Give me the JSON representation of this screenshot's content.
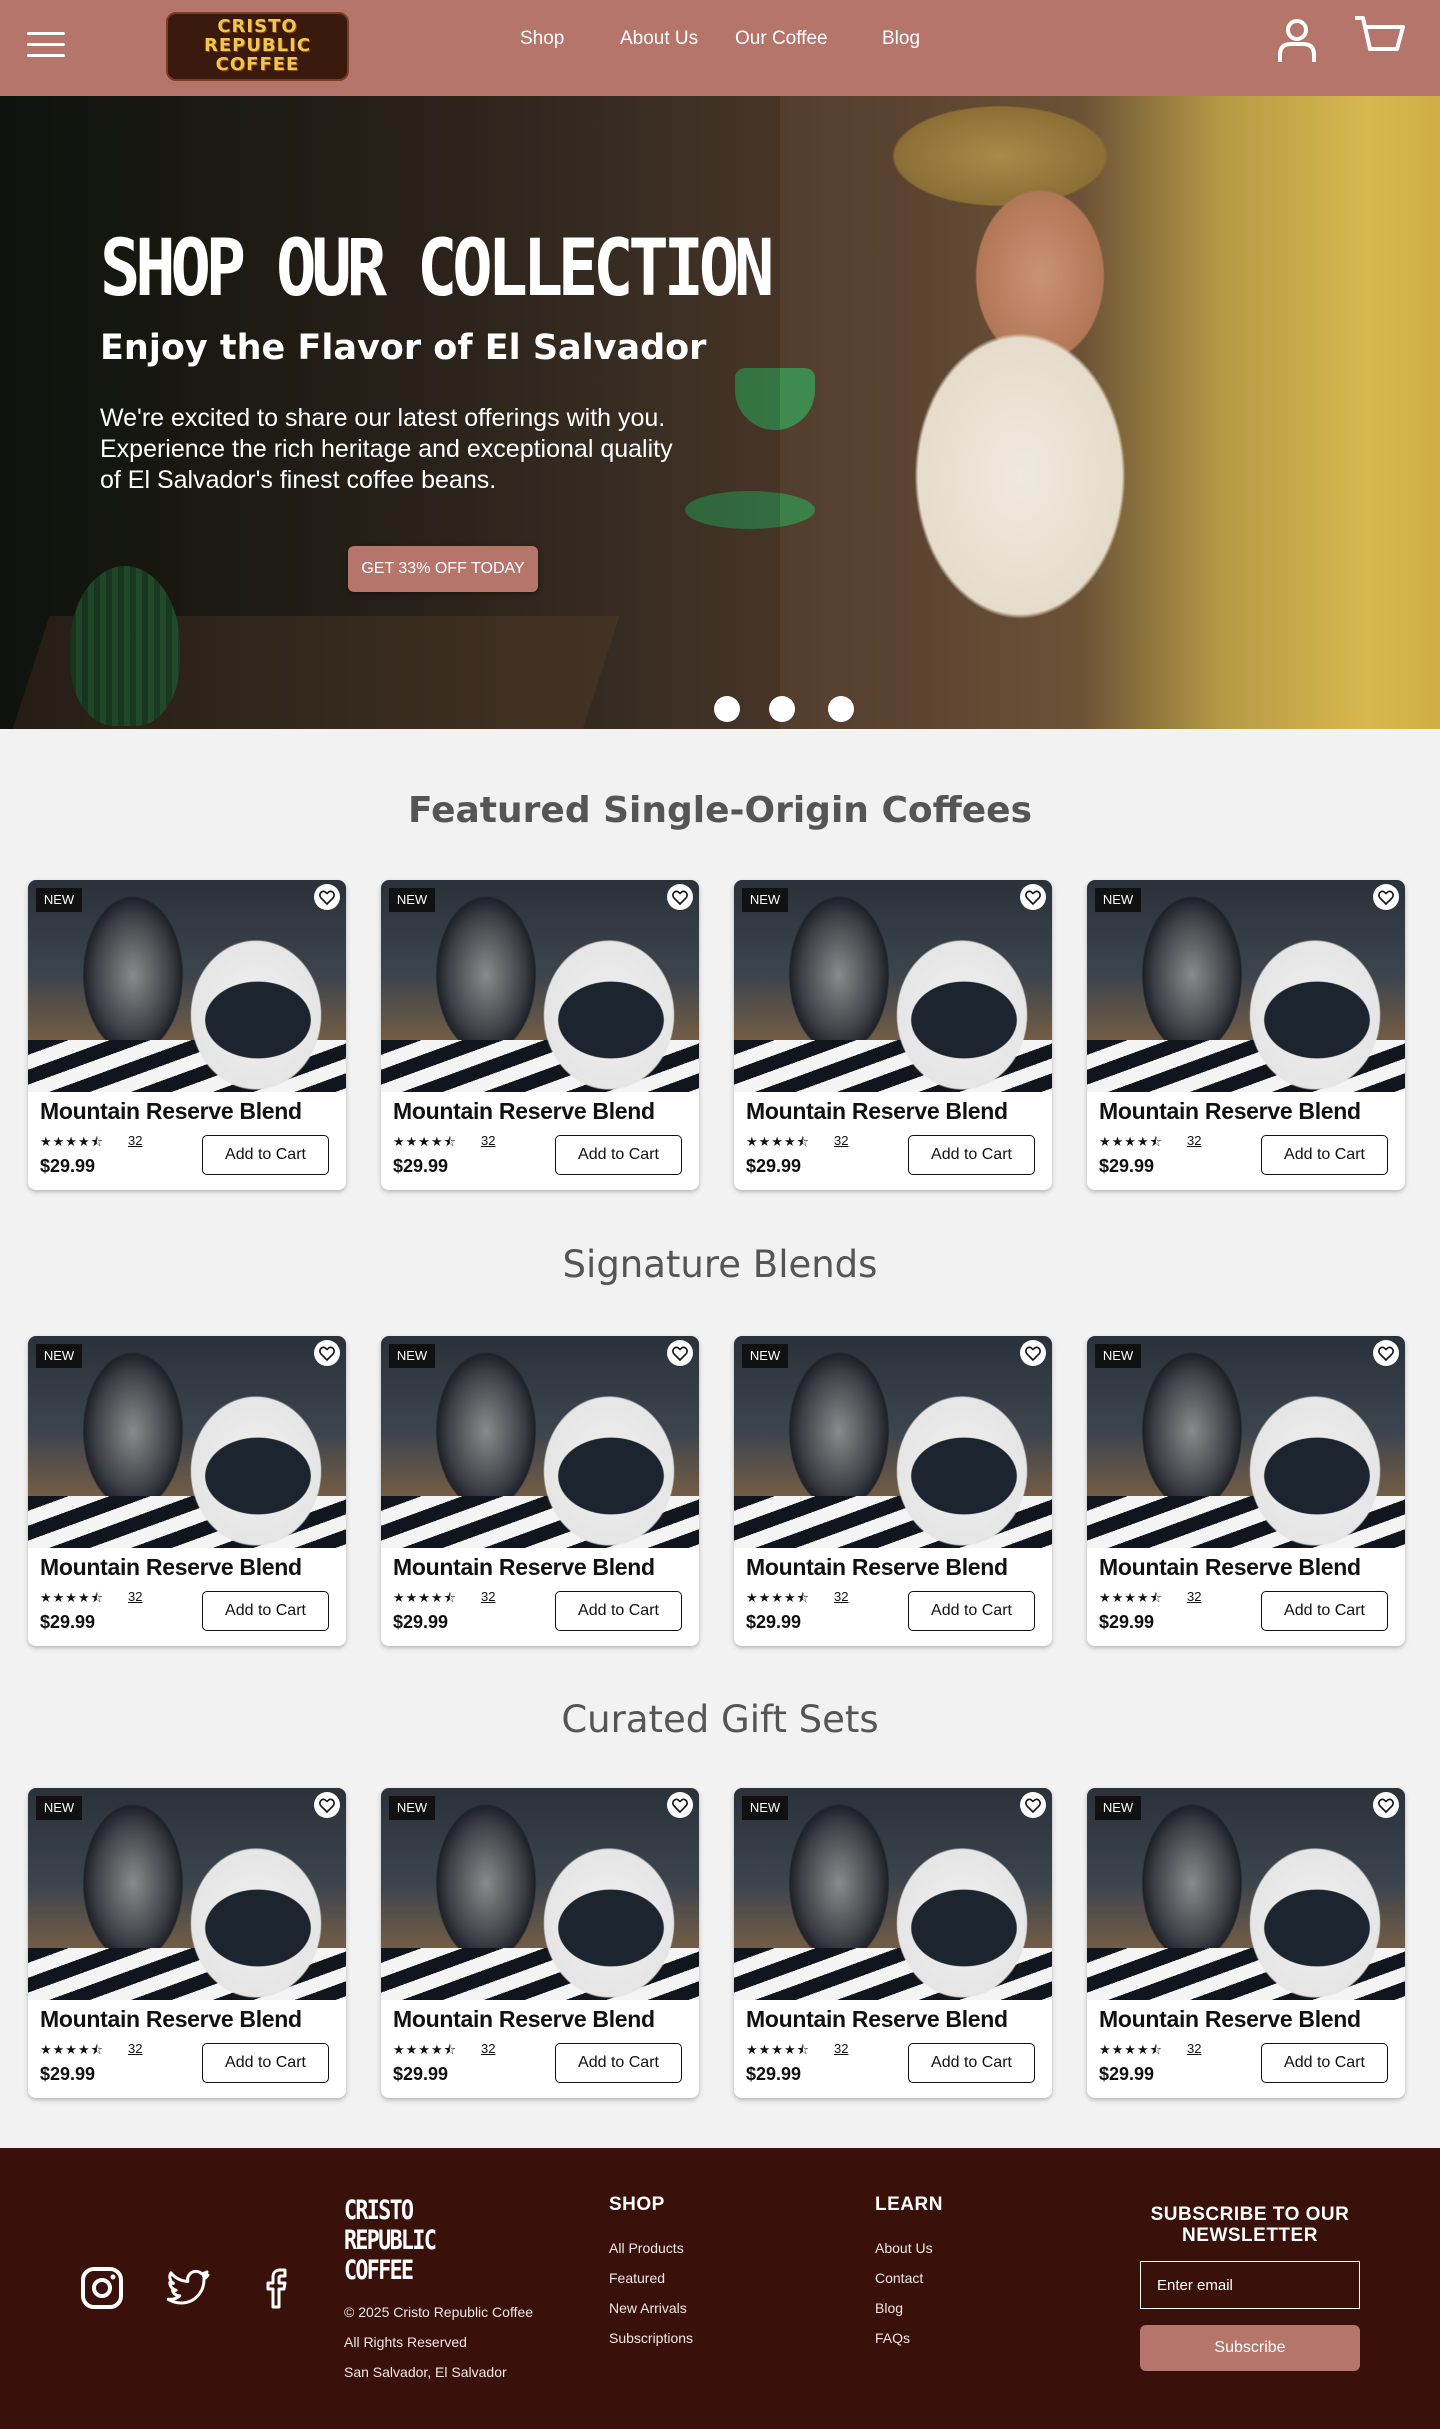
{
  "brand": {
    "logo_lines": [
      "CRISTO",
      "REPUBLIC",
      "COFFEE"
    ],
    "primary": "#b5756b",
    "dark": "#3a110a"
  },
  "nav": {
    "links": [
      "Shop",
      "About Us",
      "Our Coffee",
      "Blog"
    ],
    "icons": [
      "hamburger-menu-icon",
      "user-icon",
      "cart-icon"
    ]
  },
  "hero": {
    "title": "SHOP OUR COLLECTION",
    "subtitle": "Enjoy the Flavor of El Salvador",
    "text": "We're excited to share our latest offerings with you. Experience the rich heritage and exceptional quality of El Salvador's finest coffee beans.",
    "cta": "GET 33% OFF TODAY",
    "slides": 3
  },
  "sections": [
    {
      "title": "Featured Single-Origin Coffees",
      "products": [
        {
          "badge": "NEW",
          "name": "Mountain Reserve Blend",
          "stars": "★★★★⯪",
          "reviews": "32",
          "price": "$29.99",
          "button": "Add to Cart"
        },
        {
          "badge": "NEW",
          "name": "Mountain Reserve Blend",
          "stars": "★★★★⯪",
          "reviews": "32",
          "price": "$29.99",
          "button": "Add to Cart"
        },
        {
          "badge": "NEW",
          "name": "Mountain Reserve Blend",
          "stars": "★★★★⯪",
          "reviews": "32",
          "price": "$29.99",
          "button": "Add to Cart"
        },
        {
          "badge": "NEW",
          "name": "Mountain Reserve Blend",
          "stars": "★★★★⯪",
          "reviews": "32",
          "price": "$29.99",
          "button": "Add to Cart"
        }
      ]
    },
    {
      "title": "Signature Blends",
      "products": [
        {
          "badge": "NEW",
          "name": "Mountain Reserve Blend",
          "stars": "★★★★⯪",
          "reviews": "32",
          "price": "$29.99",
          "button": "Add to Cart"
        },
        {
          "badge": "NEW",
          "name": "Mountain Reserve Blend",
          "stars": "★★★★⯪",
          "reviews": "32",
          "price": "$29.99",
          "button": "Add to Cart"
        },
        {
          "badge": "NEW",
          "name": "Mountain Reserve Blend",
          "stars": "★★★★⯪",
          "reviews": "32",
          "price": "$29.99",
          "button": "Add to Cart"
        },
        {
          "badge": "NEW",
          "name": "Mountain Reserve Blend",
          "stars": "★★★★⯪",
          "reviews": "32",
          "price": "$29.99",
          "button": "Add to Cart"
        }
      ]
    },
    {
      "title": "Curated Gift Sets",
      "products": [
        {
          "badge": "NEW",
          "name": "Mountain Reserve Blend",
          "stars": "★★★★⯪",
          "reviews": "32",
          "price": "$29.99",
          "button": "Add to Cart"
        },
        {
          "badge": "NEW",
          "name": "Mountain Reserve Blend",
          "stars": "★★★★⯪",
          "reviews": "32",
          "price": "$29.99",
          "button": "Add to Cart"
        },
        {
          "badge": "NEW",
          "name": "Mountain Reserve Blend",
          "stars": "★★★★⯪",
          "reviews": "32",
          "price": "$29.99",
          "button": "Add to Cart"
        },
        {
          "badge": "NEW",
          "name": "Mountain Reserve Blend",
          "stars": "★★★★⯪",
          "reviews": "32",
          "price": "$29.99",
          "button": "Add to Cart"
        }
      ]
    }
  ],
  "footer": {
    "social": [
      "instagram-icon",
      "twitter-icon",
      "facebook-icon"
    ],
    "logo_lines": [
      "CRISTO",
      "REPUBLIC",
      "COFFEE"
    ],
    "copyright": "© 2025 Cristo Republic Coffee",
    "rights": "All Rights Reserved",
    "location": "San Salvador, El Salvador",
    "shop": {
      "heading": "SHOP",
      "links": [
        "All Products",
        "Featured",
        "New Arrivals",
        "Subscriptions"
      ]
    },
    "learn": {
      "heading": "LEARN",
      "links": [
        "About Us",
        "Contact",
        "Blog",
        "FAQs"
      ]
    },
    "newsletter": {
      "title": "SUBSCRIBE TO OUR NEWSLETTER",
      "placeholder": "Enter email",
      "button": "Subscribe"
    }
  }
}
